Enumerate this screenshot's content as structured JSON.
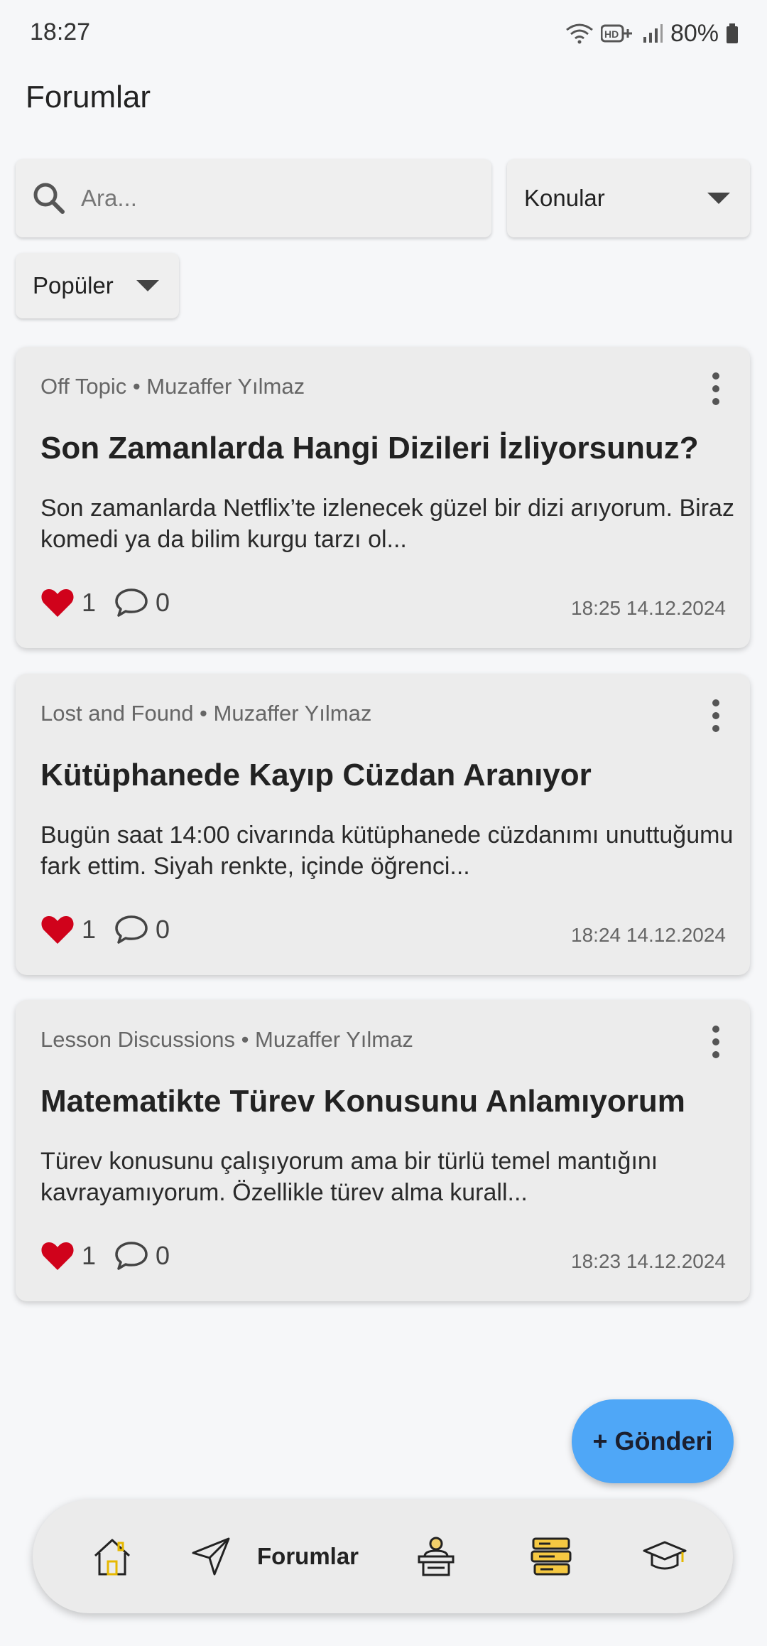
{
  "status_bar": {
    "time": "18:27",
    "battery": "80%"
  },
  "page": {
    "title": "Forumlar"
  },
  "search": {
    "placeholder": "Ara..."
  },
  "filters": {
    "topics_label": "Konular",
    "sort_label": "Popüler"
  },
  "posts": [
    {
      "meta": "Off Topic • Muzaffer Yılmaz",
      "title": "Son Zamanlarda Hangi Dizileri İzliyorsunuz?",
      "excerpt": "Son zamanlarda Netflix’te izlenecek güzel bir dizi arıyorum. Biraz komedi ya da bilim kurgu tarzı ol...",
      "likes": "1",
      "comments": "0",
      "date": "18:25 14.12.2024"
    },
    {
      "meta": "Lost and Found • Muzaffer Yılmaz",
      "title": "Kütüphanede Kayıp Cüzdan Aranıyor",
      "excerpt": "Bugün saat 14:00 civarında kütüphanede cüzdanımı unuttuğumu fark ettim. Siyah renkte, içinde öğrenci...",
      "likes": "1",
      "comments": "0",
      "date": "18:24 14.12.2024"
    },
    {
      "meta": "Lesson Discussions • Muzaffer Yılmaz",
      "title": "Matematikte Türev Konusunu Anlamıyorum",
      "excerpt": "Türev konusunu çalışıyorum ama bir türlü temel mantığını kavrayamıyorum. Özellikle türev alma kurall...",
      "likes": "1",
      "comments": "0",
      "date": "18:23 14.12.2024"
    }
  ],
  "fab": {
    "label": "+ Gönderi"
  },
  "bottom_nav": {
    "active_label": "Forumlar",
    "items": [
      "home-icon",
      "send-icon",
      "lectern-icon",
      "books-icon",
      "graduation-cap-icon"
    ]
  },
  "colors": {
    "accent": "#4fa7f7",
    "heart": "#d0021b",
    "background": "#f6f7f9",
    "card": "#ececec"
  }
}
